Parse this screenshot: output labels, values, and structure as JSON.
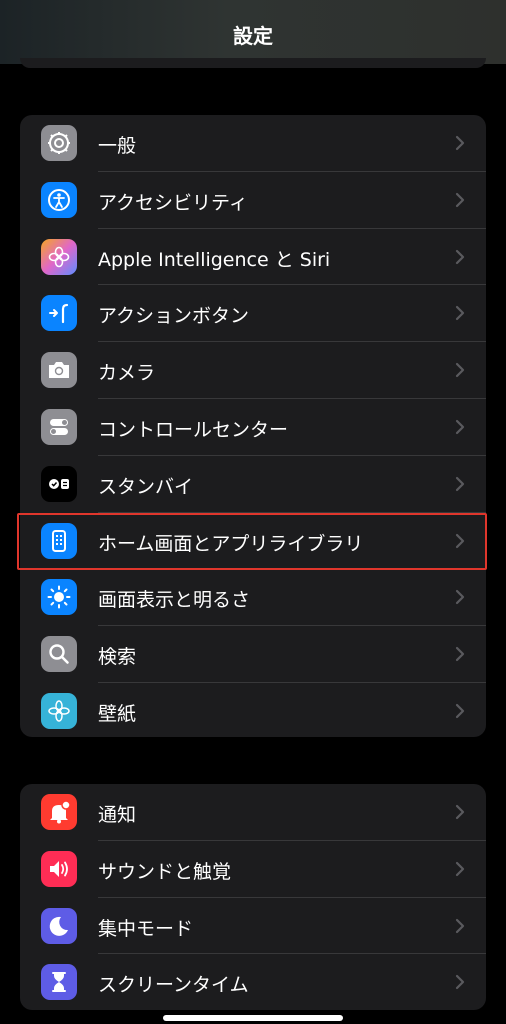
{
  "header": {
    "title": "設定"
  },
  "groups": [
    {
      "items": [
        {
          "label": "一般",
          "icon": "gear-icon",
          "color": "#8e8e93"
        },
        {
          "label": "アクセシビリティ",
          "icon": "accessibility-icon",
          "color": "#0a84ff"
        },
        {
          "label": "Apple Intelligence と Siri",
          "icon": "apple-intelligence-icon",
          "color": "#e067c9"
        },
        {
          "label": "アクションボタン",
          "icon": "action-button-icon",
          "color": "#0a84ff"
        },
        {
          "label": "カメラ",
          "icon": "camera-icon",
          "color": "#8e8e93"
        },
        {
          "label": "コントロールセンター",
          "icon": "toggles-icon",
          "color": "#8e8e93"
        },
        {
          "label": "スタンバイ",
          "icon": "standby-icon",
          "color": "#000000"
        },
        {
          "label": "ホーム画面とアプリライブラリ",
          "icon": "home-screen-icon",
          "color": "#0a84ff",
          "highlighted": true
        },
        {
          "label": "画面表示と明るさ",
          "icon": "brightness-icon",
          "color": "#0a84ff"
        },
        {
          "label": "検索",
          "icon": "search-icon",
          "color": "#8e8e93"
        },
        {
          "label": "壁紙",
          "icon": "wallpaper-icon",
          "color": "#36b3d8"
        }
      ]
    },
    {
      "items": [
        {
          "label": "通知",
          "icon": "notification-icon",
          "color": "#ff3b30"
        },
        {
          "label": "サウンドと触覚",
          "icon": "speaker-icon",
          "color": "#ff2d55"
        },
        {
          "label": "集中モード",
          "icon": "moon-icon",
          "color": "#5e5ce6"
        },
        {
          "label": "スクリーンタイム",
          "icon": "hourglass-icon",
          "color": "#5e5ce6"
        }
      ]
    }
  ],
  "highlight_color": "#e0362c"
}
